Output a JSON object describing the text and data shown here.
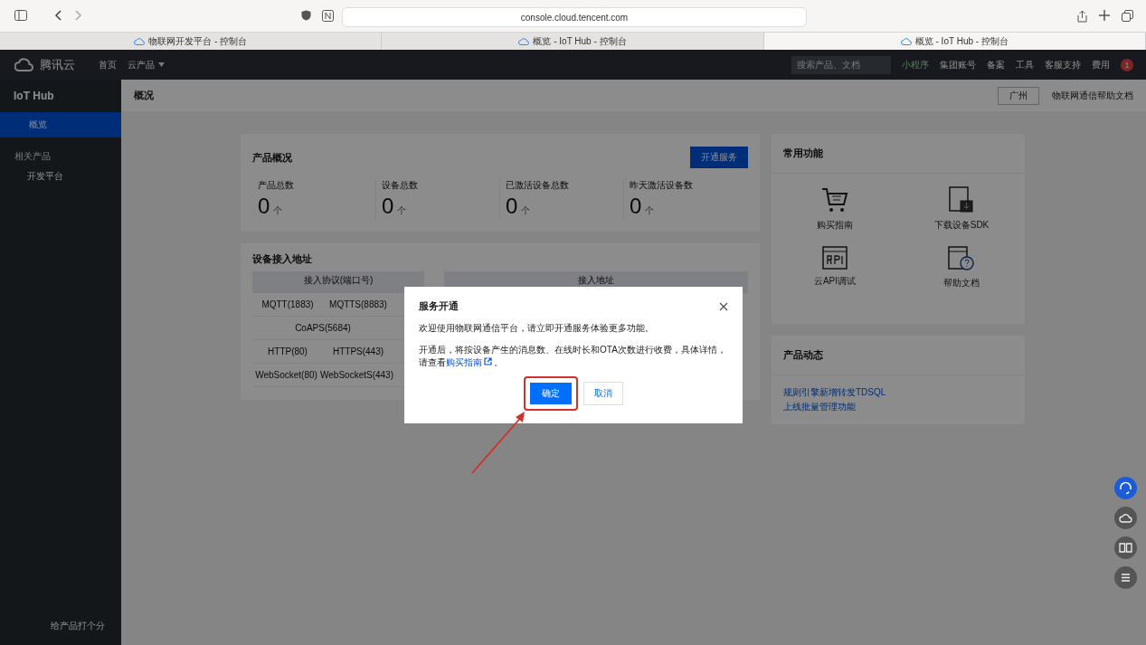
{
  "browser": {
    "url": "console.cloud.tencent.com",
    "tabs": [
      {
        "title": "物联网开发平台 - 控制台",
        "selected": false
      },
      {
        "title": "概览 - IoT Hub - 控制台",
        "selected": false
      },
      {
        "title": "概览 - IoT Hub - 控制台",
        "selected": true
      }
    ]
  },
  "topnav": {
    "logo": "腾讯云",
    "home": "首页",
    "products": "云产品",
    "search_placeholder": "搜索产品、文档",
    "mini_program": "小程序",
    "right_items": [
      "集团账号",
      "备案",
      "工具",
      "客服支持",
      "费用"
    ],
    "badge": "1"
  },
  "sidebar": {
    "title": "IoT Hub",
    "items": [
      {
        "label": "概览",
        "selected": true
      }
    ],
    "section": "相关产品",
    "links": [
      "开发平台"
    ],
    "feedback": "给产品打个分"
  },
  "header": {
    "title": "概况",
    "region": "广州",
    "help": "物联网通信帮助文档"
  },
  "overview": {
    "title": "产品概况",
    "button": "开通服务",
    "stats": [
      {
        "label": "产品总数",
        "value": "0",
        "unit": "个"
      },
      {
        "label": "设备总数",
        "value": "0",
        "unit": "个"
      },
      {
        "label": "已激活设备总数",
        "value": "0",
        "unit": "个"
      },
      {
        "label": "昨天激活设备数",
        "value": "0",
        "unit": "个"
      }
    ]
  },
  "access": {
    "title": "设备接入地址",
    "columns": [
      "接入协议(端口号)",
      "接入地址"
    ],
    "rows": [
      [
        "MQTT(1883)",
        "MQTTS(8883)"
      ],
      [
        "CoAPS(5684)"
      ],
      [
        "HTTP(80)",
        "HTTPS(443)"
      ],
      [
        "WebSocket(80)",
        "WebSocketS(443)"
      ]
    ]
  },
  "functions": {
    "title": "常用功能",
    "items": [
      {
        "kind": "cart",
        "label": "购买指南"
      },
      {
        "kind": "sdk",
        "label": "下载设备SDK"
      },
      {
        "kind": "api",
        "label": "云API调试"
      },
      {
        "kind": "help",
        "label": "帮助文档"
      }
    ]
  },
  "news": {
    "title": "产品动态",
    "items": [
      "规则引擎新增转发TDSQL",
      "上线批量管理功能"
    ]
  },
  "dialog": {
    "title": "服务开通",
    "line1": "欢迎使用物联网通信平台，请立即开通服务体验更多功能。",
    "line2": "开通后，将按设备产生的消息数、在线时长和OTA次数进行收费，具体详情，请查看",
    "link": "购买指南",
    "end": "。",
    "ok": "确定",
    "cancel": "取消"
  }
}
